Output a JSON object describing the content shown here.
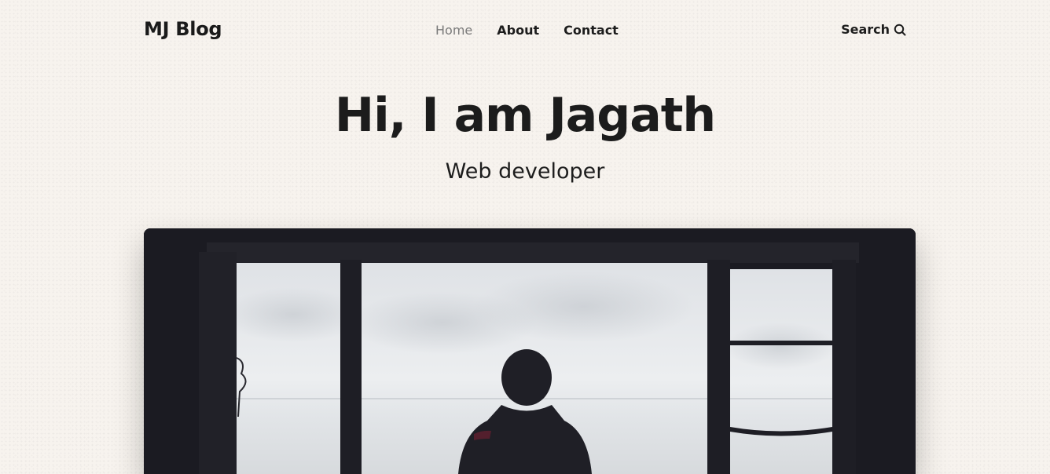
{
  "header": {
    "brand": "MJ Blog",
    "nav": [
      {
        "label": "Home",
        "active": true
      },
      {
        "label": "About",
        "active": false
      },
      {
        "label": "Contact",
        "active": false
      }
    ],
    "search_label": "Search",
    "search_icon": "search-icon"
  },
  "hero": {
    "title": "Hi, I am Jagath",
    "subtitle": "Web developer"
  },
  "colors": {
    "background": "#f7f3ee",
    "text": "#1d1d1d",
    "nav_active": "#7a7a7a",
    "image_frame": "#1c1c24"
  }
}
